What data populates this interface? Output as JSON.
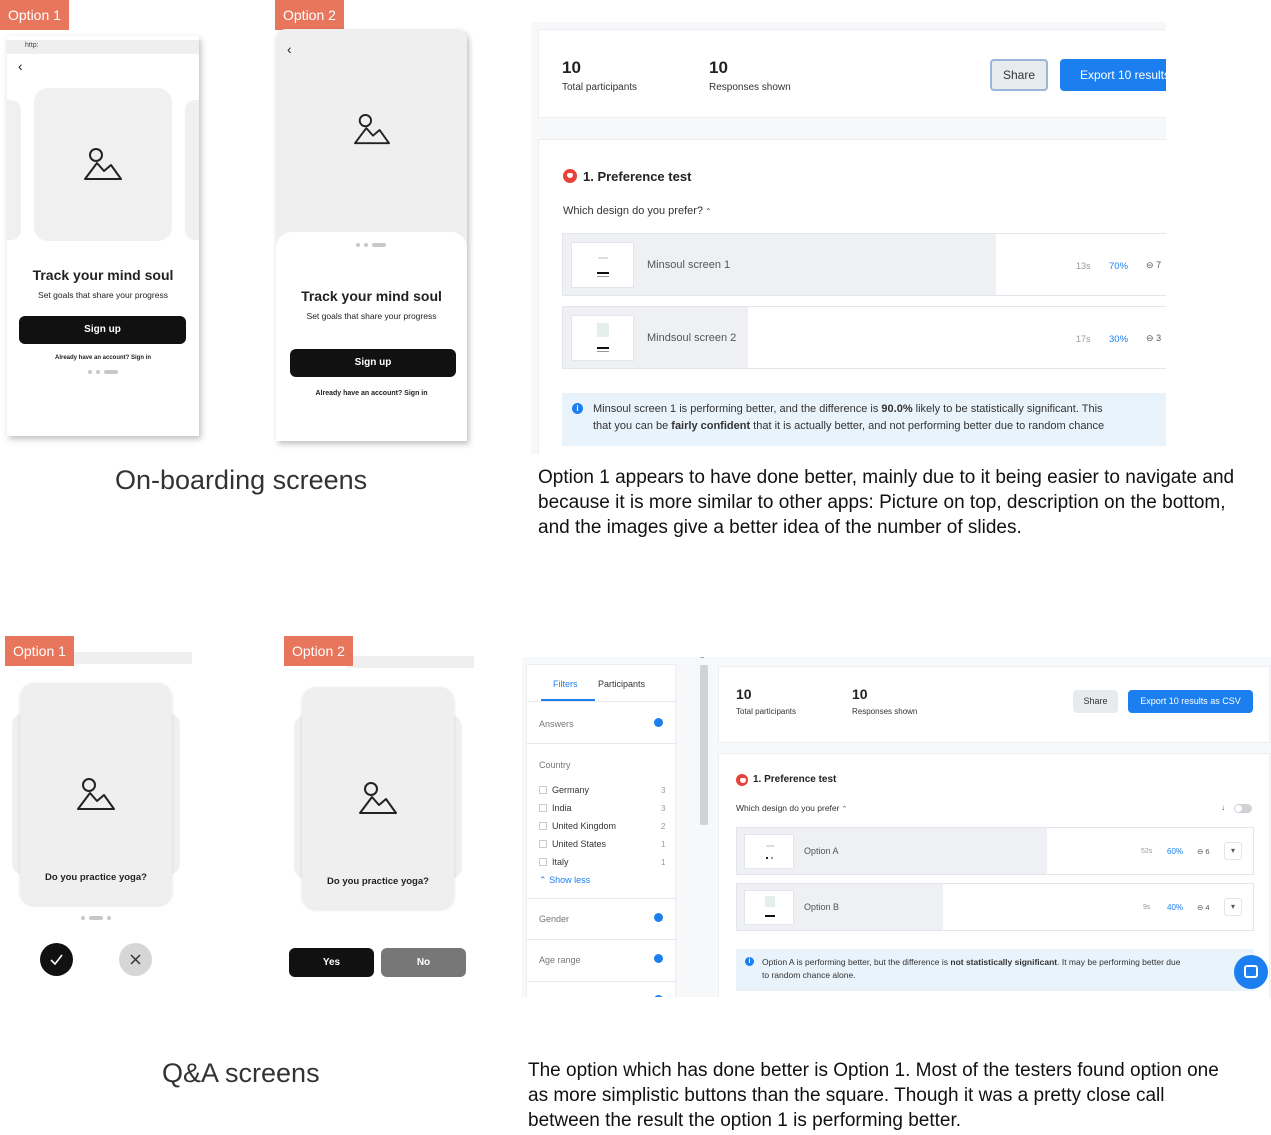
{
  "top": {
    "option1_tag": "Option 1",
    "option2_tag": "Option 2",
    "browser_url": "http:",
    "card_title": "Track your mind soul",
    "card_subtitle": "Set goals that share your progress",
    "signup": "Sign up",
    "already": "Already have an account? Sign in",
    "section_heading": "On-boarding screens",
    "results": {
      "total_participants_value": "10",
      "total_participants_label": "Total participants",
      "responses_value": "10",
      "responses_label": "Responses shown",
      "share": "Share",
      "export": "Export 10 results",
      "test_title": "1. Preference test",
      "question": "Which design do you prefer?",
      "rows": [
        {
          "label": "Minsoul screen 1",
          "time": "13s",
          "pct": "70%",
          "count": "7",
          "share": 0.7
        },
        {
          "label": "Mindsoul screen 2",
          "time": "17s",
          "pct": "30%",
          "count": "3",
          "share": 0.3
        }
      ],
      "info_pre": "Minsoul screen 1 is performing better, and the difference is ",
      "info_bold1": "90.0%",
      "info_mid": " likely to be statistically significant. This",
      "info_line2_pre": "that you can be ",
      "info_bold2": "fairly confident",
      "info_line2_post": " that it is actually better, and not performing better due to random chance"
    },
    "caption": "Option 1 appears to have done better, mainly due to it being easier to navigate and because it is more similar to other apps: Picture on top, description on the bottom, and the images give a better idea of the number of slides."
  },
  "bottom": {
    "option1_tag": "Option 1",
    "option2_tag": "Option 2",
    "question": "Do you practice yoga?",
    "yes": "Yes",
    "no": "No",
    "section_heading": "Q&A screens",
    "filters": {
      "tab_filters": "Filters",
      "tab_participants": "Participants",
      "answers": "Answers",
      "country": "Country",
      "countries": [
        {
          "name": "Germany",
          "count": "3"
        },
        {
          "name": "India",
          "count": "3"
        },
        {
          "name": "United Kingdom",
          "count": "2"
        },
        {
          "name": "United States",
          "count": "1"
        },
        {
          "name": "Italy",
          "count": "1"
        }
      ],
      "show_less": "Show less",
      "gender": "Gender",
      "age_range": "Age range"
    },
    "results": {
      "total_participants_value": "10",
      "total_participants_label": "Total participants",
      "responses_value": "10",
      "responses_label": "Responses shown",
      "share": "Share",
      "export": "Export 10 results as CSV",
      "test_title": "1. Preference test",
      "question": "Which design do you prefer",
      "rows": [
        {
          "label": "Option A",
          "time": "52s",
          "pct": "60%",
          "count": "6",
          "share": 0.6
        },
        {
          "label": "Option B",
          "time": "9s",
          "pct": "40%",
          "count": "4",
          "share": 0.4
        }
      ],
      "info_pre": "Option A is performing better, but the difference is ",
      "info_bold": "not statistically significant",
      "info_post": ". It may be performing better due",
      "info_line2": "to random chance alone."
    },
    "caption": "The option which has done better is Option 1.  Most of the testers found option one as more simplistic buttons than the square. Though it was a pretty close call between the result the option 1 is performing better."
  }
}
